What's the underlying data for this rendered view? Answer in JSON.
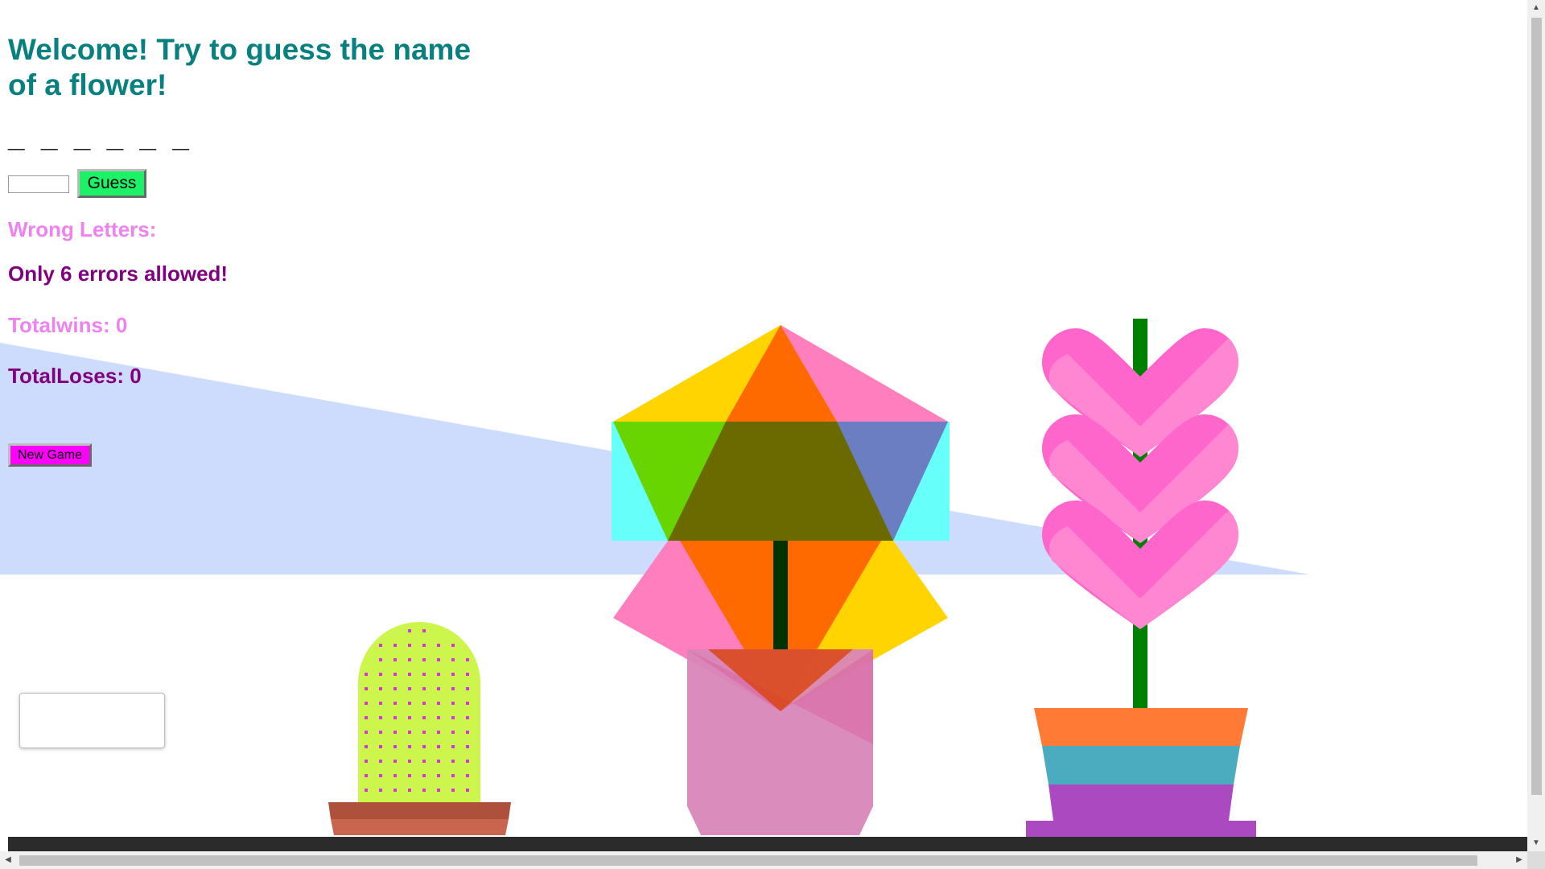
{
  "game": {
    "title": "Welcome! Try to guess the name of a flower!",
    "word_blanks": "_ _ _ _ _ _",
    "guess_input": {
      "value": "",
      "placeholder": ""
    },
    "guess_button_label": "Guess",
    "wrong_letters_label": "Wrong Letters:",
    "wrong_letters": "",
    "errors_note": "Only 6 errors allowed!",
    "total_wins_text": "Totalwins: 0",
    "total_loses_text": "TotalLoses: 0",
    "new_game_label": "New Game",
    "message": ""
  },
  "colors": {
    "title": "#098080",
    "wrong_letters": "#ee82ee",
    "errors_note": "#800080",
    "guess_button": "#1cf265",
    "new_game_button": "#ff00ff",
    "light_beam": "#cddcfd",
    "shelf": "#2b2b2b"
  },
  "scene": {
    "plants": [
      "cactus-pot",
      "star-flower-pot",
      "heart-flower-pot"
    ]
  }
}
